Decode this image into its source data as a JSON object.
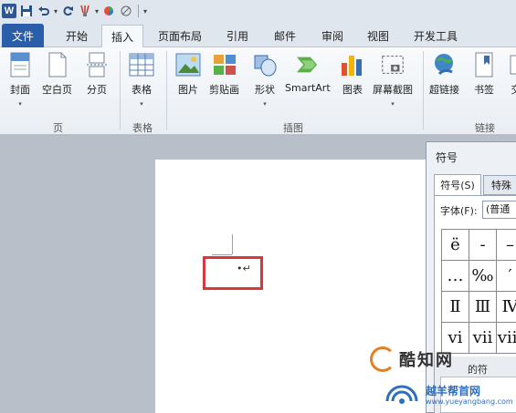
{
  "qat": {
    "logo": "W",
    "dropdown": "▾"
  },
  "tabs": [
    {
      "label": "文件"
    },
    {
      "label": "开始"
    },
    {
      "label": "插入"
    },
    {
      "label": "页面布局"
    },
    {
      "label": "引用"
    },
    {
      "label": "邮件"
    },
    {
      "label": "审阅"
    },
    {
      "label": "视图"
    },
    {
      "label": "开发工具"
    }
  ],
  "ribbon": {
    "buttons": [
      {
        "label": "封面",
        "arrow": "▾"
      },
      {
        "label": "空白页"
      },
      {
        "label": "分页"
      },
      {
        "label": "表格",
        "arrow": "▾"
      },
      {
        "label": "图片"
      },
      {
        "label": "剪贴画"
      },
      {
        "label": "形状",
        "arrow": "▾"
      },
      {
        "label": "SmartArt"
      },
      {
        "label": "图表"
      },
      {
        "label": "屏幕截图",
        "arrow": "▾"
      },
      {
        "label": "超链接"
      },
      {
        "label": "书签"
      },
      {
        "label": "交"
      }
    ],
    "groups": [
      {
        "label": "页"
      },
      {
        "label": "表格"
      },
      {
        "label": "插图"
      },
      {
        "label": "链接"
      }
    ]
  },
  "document": {
    "paragraph_mark": "•↵"
  },
  "dialog": {
    "title": "符号",
    "tabs": [
      {
        "label": "符号(S)"
      },
      {
        "label": "特殊"
      }
    ],
    "font_label": "字体(F):",
    "font_value": "(普通",
    "symbols": [
      "ë",
      "-",
      "–",
      "…",
      "‰",
      "′",
      "Ⅱ",
      "Ⅲ",
      "Ⅳ",
      "ⅵ",
      "ⅶ",
      "ⅷ"
    ],
    "recent_label": "的符"
  },
  "watermark": {
    "brand": "酷知网",
    "brand2": "越羊帮首网",
    "url": "www.yueyangbang.com"
  },
  "colors": {
    "file_tab": "#2a5ea8",
    "highlight": "#d9363e",
    "ribbon_bg": "#f4f7fa"
  }
}
